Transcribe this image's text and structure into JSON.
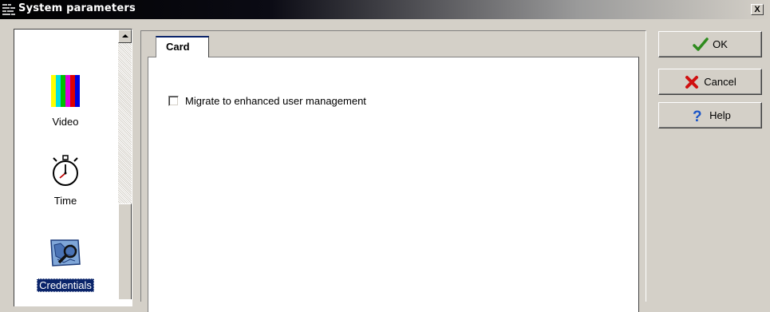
{
  "window": {
    "title": "System parameters",
    "close_glyph": "X"
  },
  "nav": {
    "items": [
      {
        "label": "Video",
        "icon": "color-bars-icon",
        "selected": false
      },
      {
        "label": "Time",
        "icon": "stopwatch-icon",
        "selected": false
      },
      {
        "label": "Credentials",
        "icon": "credentials-map-icon",
        "selected": true
      }
    ]
  },
  "tabs": [
    {
      "label": "Card",
      "active": true
    }
  ],
  "card": {
    "migrate_checkbox": {
      "label": "Migrate to enhanced user management",
      "checked": false
    }
  },
  "buttons": {
    "ok": {
      "label": "OK",
      "icon": "checkmark-icon",
      "icon_color": "#2e8b1e"
    },
    "cancel": {
      "label": "Cancel",
      "icon": "red-x-icon",
      "icon_color": "#d01010"
    },
    "help": {
      "label": "Help",
      "icon": "question-mark-icon",
      "icon_color": "#1a55c8"
    }
  },
  "colors": {
    "selection": "#0a246a",
    "dialog_face": "#d4d0c8"
  }
}
